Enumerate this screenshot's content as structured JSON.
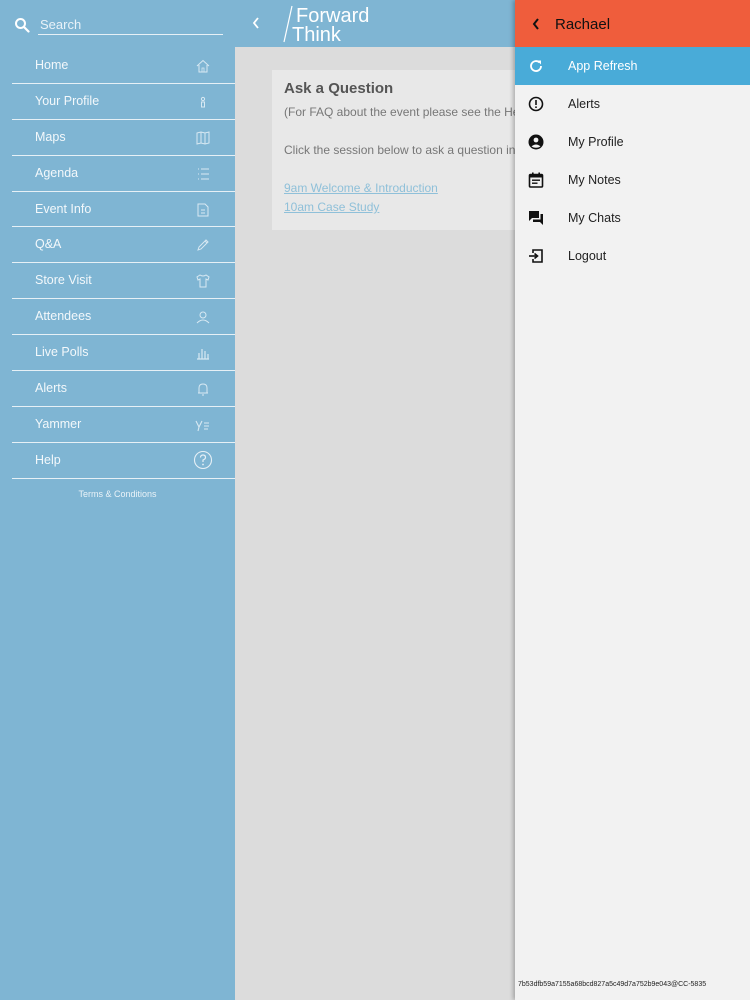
{
  "search": {
    "placeholder": "Search"
  },
  "sidebar": {
    "items": [
      {
        "label": "Home",
        "icon": "home-icon"
      },
      {
        "label": "Your Profile",
        "icon": "profile-icon"
      },
      {
        "label": "Maps",
        "icon": "map-icon"
      },
      {
        "label": "Agenda",
        "icon": "agenda-list-icon"
      },
      {
        "label": "Event Info",
        "icon": "document-icon"
      },
      {
        "label": "Q&A",
        "icon": "pen-icon"
      },
      {
        "label": "Store Visit",
        "icon": "shirt-icon"
      },
      {
        "label": "Attendees",
        "icon": "attendees-icon"
      },
      {
        "label": "Live Polls",
        "icon": "bar-chart-icon"
      },
      {
        "label": "Alerts",
        "icon": "bell-icon"
      },
      {
        "label": "Yammer",
        "icon": "yammer-icon"
      },
      {
        "label": "Help",
        "icon": "help-circle-icon"
      }
    ],
    "terms": "Terms & Conditions"
  },
  "header": {
    "logo_line1": "Forward",
    "logo_line2": "Think"
  },
  "main": {
    "title": "Ask a Question",
    "faq_text": "(For FAQ about the event please see the Hel",
    "instruction": "Click the session below to ask a question in t",
    "sessions": [
      "9am Welcome & Introduction",
      "10am Case Study"
    ]
  },
  "drawer": {
    "user_name": "Rachael",
    "items": [
      {
        "label": "App Refresh",
        "icon": "refresh-icon",
        "active": true
      },
      {
        "label": "Alerts",
        "icon": "alert-icon"
      },
      {
        "label": "My Profile",
        "icon": "account-circle-icon"
      },
      {
        "label": "My Notes",
        "icon": "calendar-notes-icon"
      },
      {
        "label": "My Chats",
        "icon": "chat-icon"
      },
      {
        "label": "Logout",
        "icon": "logout-icon"
      }
    ],
    "footer_id": "7b53dfb59a7155a68bcd827a5c49d7a752b9e043@CC-5835"
  },
  "colors": {
    "sidebar_bg": "#7fb5d3",
    "drawer_header": "#ef5d3c",
    "drawer_active": "#49abd8",
    "link": "#8fc0d9"
  }
}
